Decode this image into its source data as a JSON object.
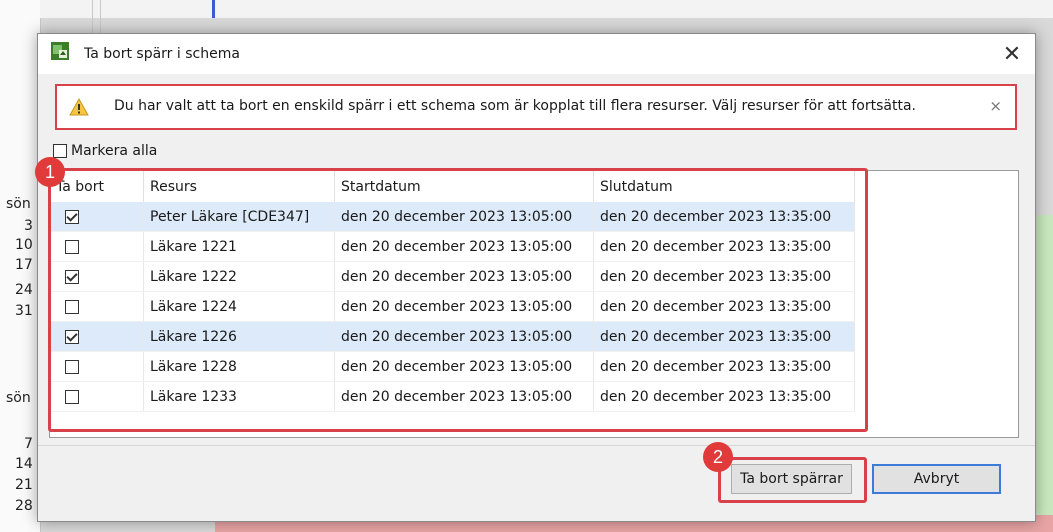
{
  "background": {
    "calendar_labels": [
      "sön",
      "3",
      "10",
      "17",
      "24",
      "31",
      "sön",
      "7",
      "14",
      "21",
      "28"
    ]
  },
  "dialog": {
    "title": "Ta bort spärr i schema",
    "close_symbol": "✕",
    "warning": {
      "icon": "warning-icon",
      "text": "Du har valt att ta bort en enskild spärr i ett schema som är kopplat till flera resurser. Välj resurser för att fortsätta.",
      "close_symbol": "⨯"
    },
    "mark_all_label": "Markera alla",
    "table": {
      "headers": [
        "Ta bort",
        "Resurs",
        "Startdatum",
        "Slutdatum"
      ],
      "rows": [
        {
          "checked": true,
          "selected": true,
          "resource": "Peter Läkare [CDE347]",
          "start": "den 20 december 2023 13:05:00",
          "end": "den 20 december 2023 13:35:00"
        },
        {
          "checked": false,
          "selected": false,
          "resource": "Läkare 1221",
          "start": "den 20 december 2023 13:05:00",
          "end": "den 20 december 2023 13:35:00"
        },
        {
          "checked": true,
          "selected": false,
          "resource": "Läkare 1222",
          "start": "den 20 december 2023 13:05:00",
          "end": "den 20 december 2023 13:35:00"
        },
        {
          "checked": false,
          "selected": false,
          "resource": "Läkare 1224",
          "start": "den 20 december 2023 13:05:00",
          "end": "den 20 december 2023 13:35:00"
        },
        {
          "checked": true,
          "selected": true,
          "resource": "Läkare 1226",
          "start": "den 20 december 2023 13:05:00",
          "end": "den 20 december 2023 13:35:00"
        },
        {
          "checked": false,
          "selected": false,
          "resource": "Läkare 1228",
          "start": "den 20 december 2023 13:05:00",
          "end": "den 20 december 2023 13:35:00"
        },
        {
          "checked": false,
          "selected": false,
          "resource": "Läkare 1233",
          "start": "den 20 december 2023 13:05:00",
          "end": "den 20 december 2023 13:35:00"
        }
      ]
    },
    "buttons": {
      "delete_label": "Ta bort spärrar",
      "cancel_label": "Avbryt"
    },
    "annotations": {
      "badge1": "1",
      "badge2": "2"
    }
  },
  "colors": {
    "highlight_red": "#d9414a",
    "selected_row": "#dceafa",
    "focus_blue": "#3d7ad9"
  }
}
